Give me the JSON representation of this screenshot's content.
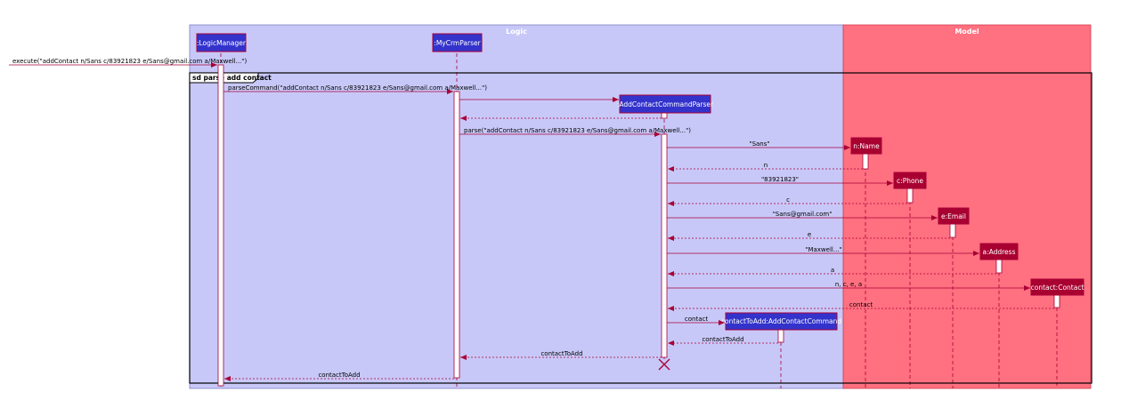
{
  "boxes": {
    "logic": "Logic",
    "model": "Model"
  },
  "participants": {
    "logic_manager": ":LogicManager",
    "parser": ":MyCrmParser",
    "add_parser": ":AddContactCommandParser",
    "name": "n:Name",
    "phone": "c:Phone",
    "email": "e:Email",
    "address": "a:Address",
    "contact": "contact:Contact",
    "command": "contactToAdd:AddContactCommand"
  },
  "frame": {
    "label": "sd parse add contact"
  },
  "messages": {
    "execute": "execute(\"addContact n/Sans c/83921823 e/Sans@gmail.com a/Maxwell...\")",
    "parse_command": "parseCommand(\"addContact n/Sans c/83921823 e/Sans@gmail.com a/Maxwell...\")",
    "parse": "parse(\"addContact n/Sans c/83921823 e/Sans@gmail.com a/Maxwell...\")",
    "name_arg": "\"Sans\"",
    "name_ret": "n",
    "phone_arg": "\"83921823\"",
    "phone_ret": "c",
    "email_arg": "\"Sans@gmail.com\"",
    "email_ret": "e",
    "address_arg": "\"Maxwell...\"",
    "address_ret": "a",
    "contact_args": "n, c, e, a",
    "contact_ret": "contact",
    "command_arg": "contact",
    "command_ret": "contactToAdd",
    "parse_ret": "contactToAdd",
    "final_ret": "contactToAdd"
  },
  "colors": {
    "logic_box": "#c8c8f8",
    "model_box": "#ff7080",
    "logic_participant": "#3333cc",
    "model_participant": "#a80030",
    "arrow": "#a80036",
    "lifeline": "#a80036",
    "frame": "#000000"
  }
}
